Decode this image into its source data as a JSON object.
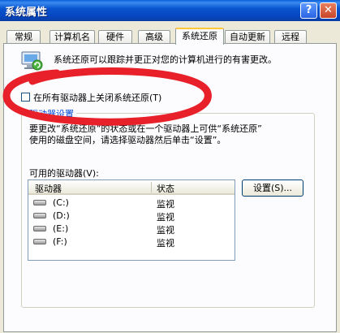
{
  "window": {
    "title": "系统属性"
  },
  "titlebar": {
    "help_glyph": "?",
    "close_glyph": "✕"
  },
  "tabs": [
    {
      "label": "常规"
    },
    {
      "label": "计算机名"
    },
    {
      "label": "硬件"
    },
    {
      "label": "高级"
    },
    {
      "label": "系统还原",
      "active": true
    },
    {
      "label": "自动更新"
    },
    {
      "label": "远程"
    }
  ],
  "panel": {
    "intro": "系统还原可以跟踪并更正对您的计算机进行的有害更改。",
    "icon": "system-restore-icon",
    "checkbox_label": "在所有驱动器上关闭系统还原(T)",
    "checkbox_checked": false,
    "group": {
      "title": "驱动器设置",
      "description_line1": "要更改“系统还原”的状态或在一个驱动器上可供“系统还原”",
      "description_line2": "使用的磁盘空间，请选择驱动器然后单击“设置”。",
      "available_label": "可用的驱动器(V):",
      "columns": [
        "驱动器",
        "状态"
      ],
      "drives": [
        {
          "name": "(C:)",
          "status": "监视"
        },
        {
          "name": "(D:)",
          "status": "监视"
        },
        {
          "name": "(E:)",
          "status": "监视"
        },
        {
          "name": "(F:)",
          "status": "监视"
        }
      ],
      "settings_button": "设置(S)..."
    }
  },
  "annotation_color": "#e8202a"
}
